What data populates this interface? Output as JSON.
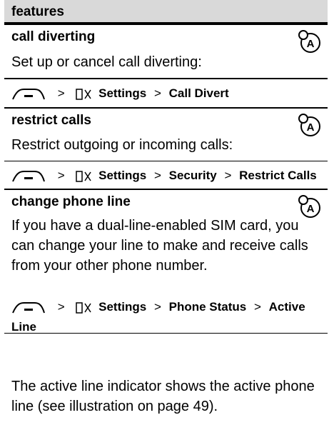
{
  "header": {
    "title": "features"
  },
  "sections": [
    {
      "title": "call diverting",
      "icon": "network-service-icon",
      "description": "Set up or cancel call diverting:",
      "path": [
        "Settings",
        "Call Divert"
      ]
    },
    {
      "title": "restrict calls",
      "icon": "network-service-icon",
      "description": "Restrict outgoing or incoming calls:",
      "path": [
        "Settings",
        "Security",
        "Restrict Calls"
      ]
    },
    {
      "title": "change phone line",
      "icon": "network-service-icon",
      "description": "If you have a dual-line-enabled SIM card, you can change your line to make and receive calls from your other phone number.",
      "path": [
        "Settings",
        "Phone Status",
        "Active Line"
      ],
      "note": "The active line indicator shows the active phone line (see illustration on page 49)."
    }
  ]
}
